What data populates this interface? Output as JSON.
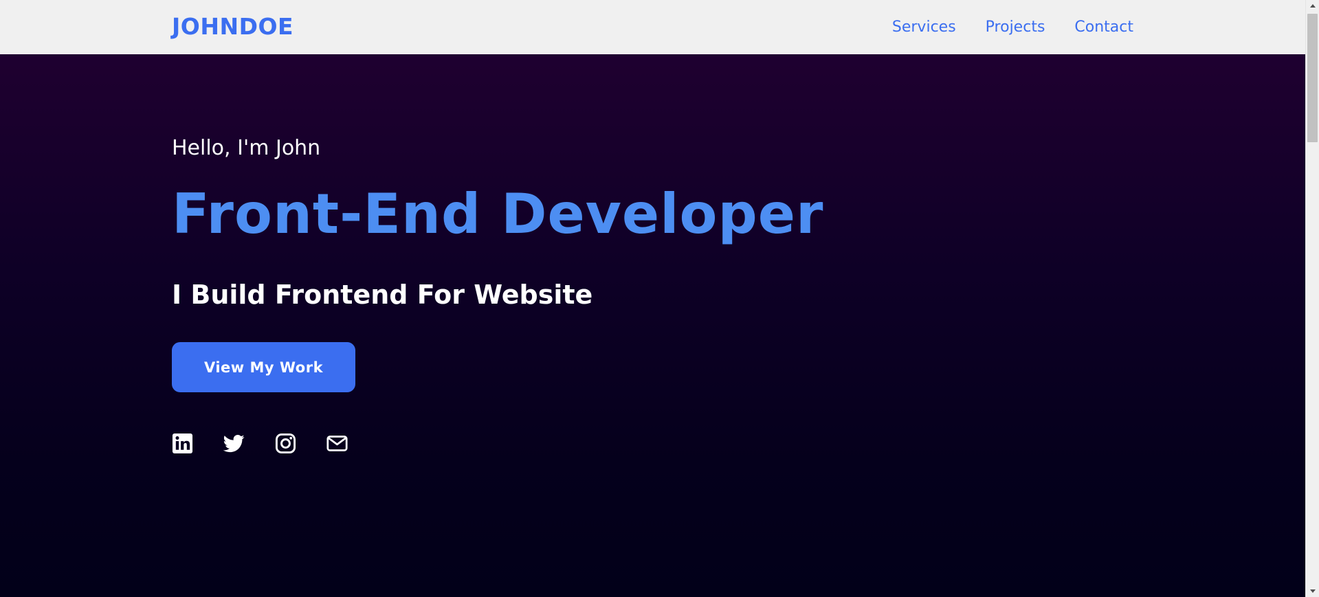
{
  "header": {
    "logo": "JOHNDOE",
    "nav": [
      {
        "label": "Services"
      },
      {
        "label": "Projects"
      },
      {
        "label": "Contact"
      }
    ]
  },
  "hero": {
    "greeting": "Hello, I'm John",
    "headline": "Front-End Developer",
    "subheadline": "I Build Frontend For Website",
    "cta_label": "View My Work",
    "socials": [
      {
        "icon": "linkedin-icon"
      },
      {
        "icon": "twitter-icon"
      },
      {
        "icon": "instagram-icon"
      },
      {
        "icon": "mail-icon"
      }
    ]
  },
  "colors": {
    "accent": "#3b6ef0",
    "headline": "#4d8ef2",
    "nav_background": "#f0f0f0",
    "hero_top": "#1f0030",
    "hero_bottom": "#020019"
  }
}
